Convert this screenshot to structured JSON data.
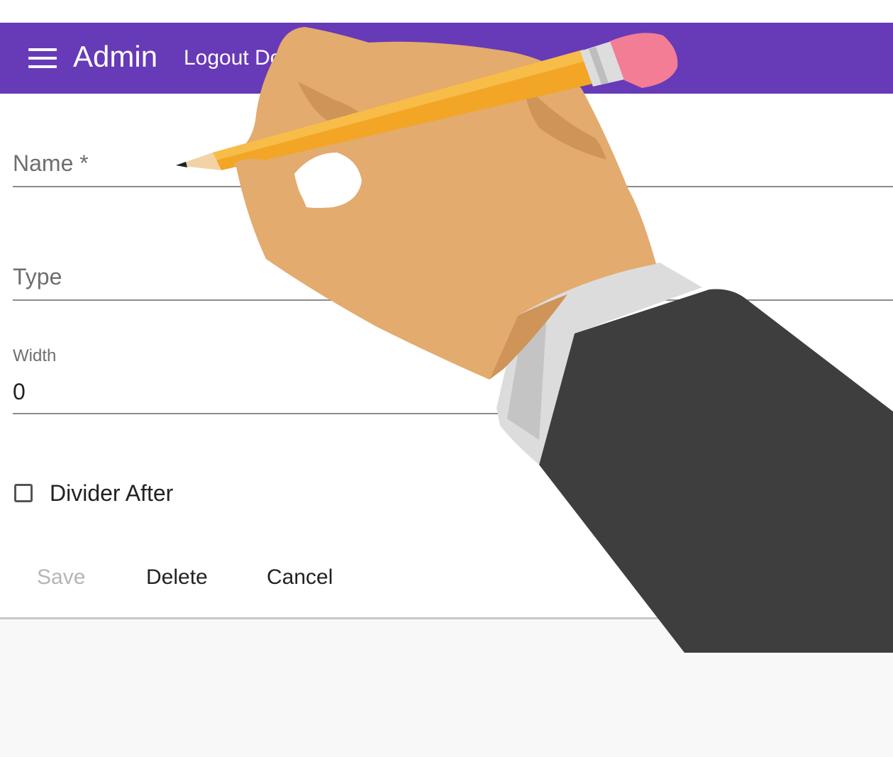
{
  "appbar": {
    "title": "Admin",
    "logout_label": "Logout Do",
    "menu_icon": "hamburger-menu-icon",
    "color": "#673ab7"
  },
  "form": {
    "name_placeholder": "Name *",
    "type_placeholder": "Type",
    "width_label": "Width",
    "width_value": "0",
    "divider_after_label": "Divider After",
    "divider_after_checked": false
  },
  "buttons": {
    "save_label": "Save",
    "delete_label": "Delete",
    "cancel_label": "Cancel",
    "save_disabled": true
  },
  "overlay": {
    "illustration": "hand-with-pencil-illustration"
  }
}
